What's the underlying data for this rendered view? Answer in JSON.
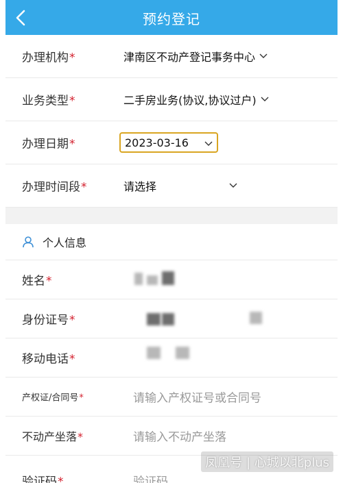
{
  "header": {
    "title": "预约登记",
    "back_icon": "chevron-left-icon"
  },
  "form": {
    "institution": {
      "label": "办理机构",
      "required_mark": "*",
      "value": "津南区不动产登记事务中心"
    },
    "business_type": {
      "label": "业务类型",
      "required_mark": "*",
      "value": "二手房业务(协议,协议过户)"
    },
    "date": {
      "label": "办理日期",
      "required_mark": "*",
      "value": "2023-03-16"
    },
    "time_slot": {
      "label": "办理时间段",
      "required_mark": "*",
      "value": "请选择"
    }
  },
  "personal": {
    "section_title": "个人信息",
    "name": {
      "label": "姓名",
      "required_mark": "*"
    },
    "id_number": {
      "label": "身份证号",
      "required_mark": "*"
    },
    "phone": {
      "label": "移动电话",
      "required_mark": "*"
    },
    "cert_number": {
      "label": "产权证/合同号",
      "required_mark": "*",
      "placeholder": "请输入产权证号或合同号"
    },
    "location": {
      "label": "不动产坐落",
      "required_mark": "*",
      "placeholder": "请输入不动产坐落"
    },
    "captcha": {
      "label": "验证码",
      "required_mark": "*",
      "placeholder": "验证码"
    }
  },
  "watermark": {
    "text": "凤凰号 | 心城以北plus"
  },
  "colors": {
    "header": "#35a9e8",
    "required": "#d31f2d",
    "date_border": "#d9a520"
  }
}
